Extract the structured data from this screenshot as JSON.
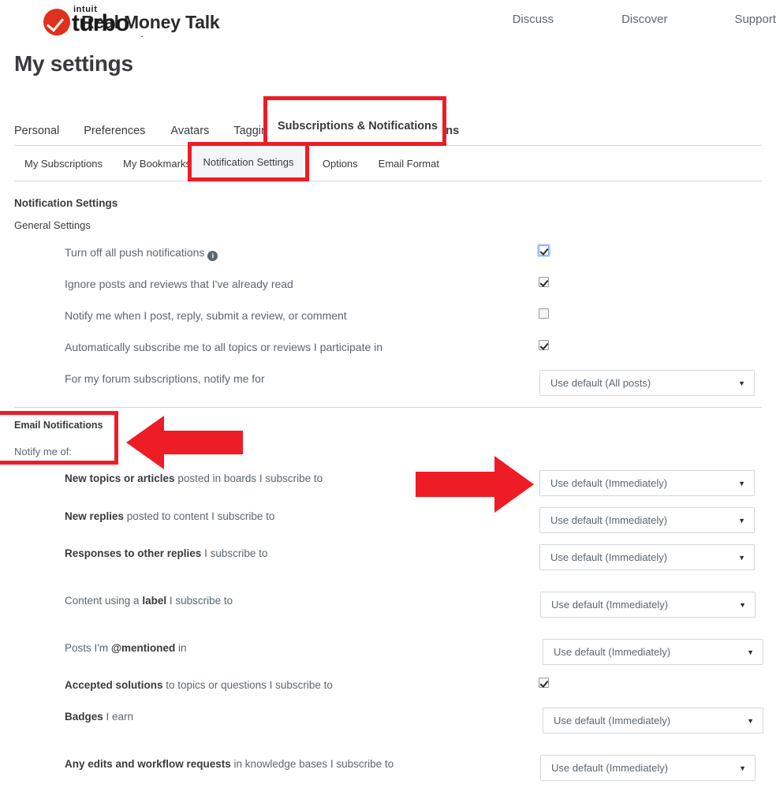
{
  "header": {
    "brand": {
      "intuit": "intuit",
      "turbo": "turbo",
      "turbo_dot": ".",
      "product": "Real Money Talk",
      "mark_color": "#e0301e"
    },
    "nav": [
      {
        "label": "Discuss"
      },
      {
        "label": "Discover"
      },
      {
        "label": "Support"
      }
    ]
  },
  "page": {
    "title": "My settings"
  },
  "primary_tabs": [
    {
      "label": "Personal",
      "active": false
    },
    {
      "label": "Preferences",
      "active": false
    },
    {
      "label": "Avatars",
      "active": false
    },
    {
      "label": "Tagging",
      "active": false
    },
    {
      "label": "Subscriptions & Notifications",
      "active": true
    }
  ],
  "secondary_tabs": [
    {
      "label": "My Subscriptions",
      "active": false
    },
    {
      "label": "My Bookmarks",
      "active": false
    },
    {
      "label": "Notification Settings",
      "active": true
    },
    {
      "label": "Options",
      "active": false
    },
    {
      "label": "Email Format",
      "active": false
    }
  ],
  "sections": {
    "notification_settings_heading": "Notification Settings",
    "general_settings_heading": "General Settings",
    "email_notifications_heading": "Email Notifications",
    "notify_me_of_label": "Notify me of:"
  },
  "general_settings_rows": [
    {
      "label": "Turn off all push notifications",
      "has_info_icon": true,
      "info_icon_glyph": "i",
      "control": "checkbox",
      "checked": true,
      "focused": true
    },
    {
      "label": "Ignore posts and reviews that I've already read",
      "has_info_icon": false,
      "control": "checkbox",
      "checked": true,
      "focused": false
    },
    {
      "label": "Notify me when I post, reply, submit a review, or comment",
      "has_info_icon": false,
      "control": "checkbox",
      "checked": false,
      "focused": false
    },
    {
      "label": "Automatically subscribe me to all topics or reviews I participate in",
      "has_info_icon": false,
      "control": "checkbox",
      "checked": true,
      "focused": false
    },
    {
      "label": "For my forum subscriptions, notify me for",
      "has_info_icon": false,
      "control": "select",
      "value": "Use default (All posts)"
    }
  ],
  "email_notification_rows": [
    {
      "label_bold": "New topics or articles",
      "label_rest": " posted in boards I subscribe to",
      "control": "select",
      "value": "Use default (Immediately)"
    },
    {
      "label_bold": "New replies",
      "label_rest": " posted to content I subscribe to",
      "control": "select",
      "value": "Use default (Immediately)"
    },
    {
      "label_bold": "Responses to other replies",
      "label_rest": " I subscribe to",
      "control": "select",
      "value": "Use default (Immediately)"
    },
    {
      "label_pre": "Content using a ",
      "label_bold": "label",
      "label_rest": " I subscribe to",
      "control": "select",
      "value": "Use default (Immediately)"
    },
    {
      "label_pre": "Posts I'm ",
      "label_bold": "@mentioned",
      "label_rest": " in",
      "control": "select",
      "value": "Use default (Immediately)"
    },
    {
      "label_bold": "Accepted solutions",
      "label_rest": " to topics or questions I subscribe to",
      "control": "checkbox",
      "checked": true,
      "focused": false
    },
    {
      "label_bold": "Badges",
      "label_rest": " I earn",
      "control": "select",
      "value": "Use default (Immediately)"
    },
    {
      "label_bold": "Any edits and workflow requests",
      "label_rest": " in knowledge bases I subscribe to",
      "control": "select",
      "value": "Use default (Immediately)"
    }
  ],
  "select_caret_glyph": "▼",
  "annotations": {
    "color": "#ee1c25",
    "boxes": [
      {
        "name": "highlight-subscriptions-notifications-tab"
      },
      {
        "name": "highlight-notification-settings-tab"
      },
      {
        "name": "highlight-email-notifications-heading"
      }
    ],
    "arrows": [
      {
        "name": "arrow-pointing-left-at-email-notifications",
        "direction": "left"
      },
      {
        "name": "arrow-pointing-right-at-first-dropdown",
        "direction": "right"
      }
    ]
  },
  "colors": {
    "accent_blue": "#0077c5",
    "annotation_red": "#ee1c25",
    "brand_red": "#e0301e",
    "text_primary": "#393a3d",
    "text_secondary": "#5b6770",
    "border": "#d4d7dc"
  }
}
